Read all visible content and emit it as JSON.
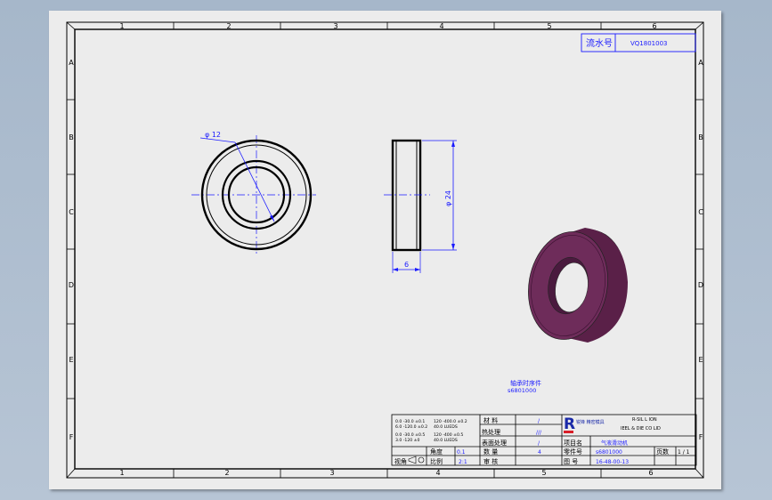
{
  "border": {
    "columns": [
      "1",
      "2",
      "3",
      "4",
      "5",
      "6"
    ],
    "rows": [
      "A",
      "B",
      "C",
      "D",
      "E",
      "F"
    ]
  },
  "serial_box": {
    "label": "流水号",
    "value": "VQ1801003"
  },
  "front_view": {
    "dim_label": "φ 12"
  },
  "side_view": {
    "dim_height": "φ 24",
    "dim_width": "6"
  },
  "iso_view": {
    "color": "#6e2c5a"
  },
  "part_note": {
    "title": "轴承时序件",
    "code": "s6801000"
  },
  "title_block": {
    "tolerance_lines": [
      "0.0 -30.0 ±0.1",
      "6.0 -120.0 ±0.2",
      "0.0 -30.0 ±0.5",
      "3.0 -120 ±0"
    ],
    "tolerance_lines_right": [
      "120 -400.0 ±0.2",
      "40.0 LUEDS",
      "120 -400 ±0.5",
      "40.0 LUEDS"
    ],
    "precision_label": "精度",
    "precision_value": "0.1",
    "mark_label": "角度",
    "mark_value": "0.1",
    "projection_label": "视角",
    "scale_label": "比例",
    "scale_value": "2:1",
    "material_label": "材 料",
    "material_value": "/",
    "heat_label": "热处理",
    "heat_value": "///",
    "surface_label": "表面处理",
    "surface_value": "/",
    "qty_label": "数 量",
    "qty_value": "4",
    "unit_label": "单 位",
    "unit_value": "/",
    "review_label": "审 核",
    "company_logo_text": "R",
    "company_name_cn": "锐锋\n精密模具",
    "company_name_en1": "R-SIL L ION",
    "company_name_en2": "IEEL & DIE CO LID",
    "project_label": "项目名",
    "project_value": "气液滑动机",
    "part_label": "零件号",
    "part_value": "s6801000",
    "drawing_label": "图 号",
    "drawing_value": "16-48-00-13",
    "page_label": "页数",
    "page_value": "1 / 1"
  }
}
